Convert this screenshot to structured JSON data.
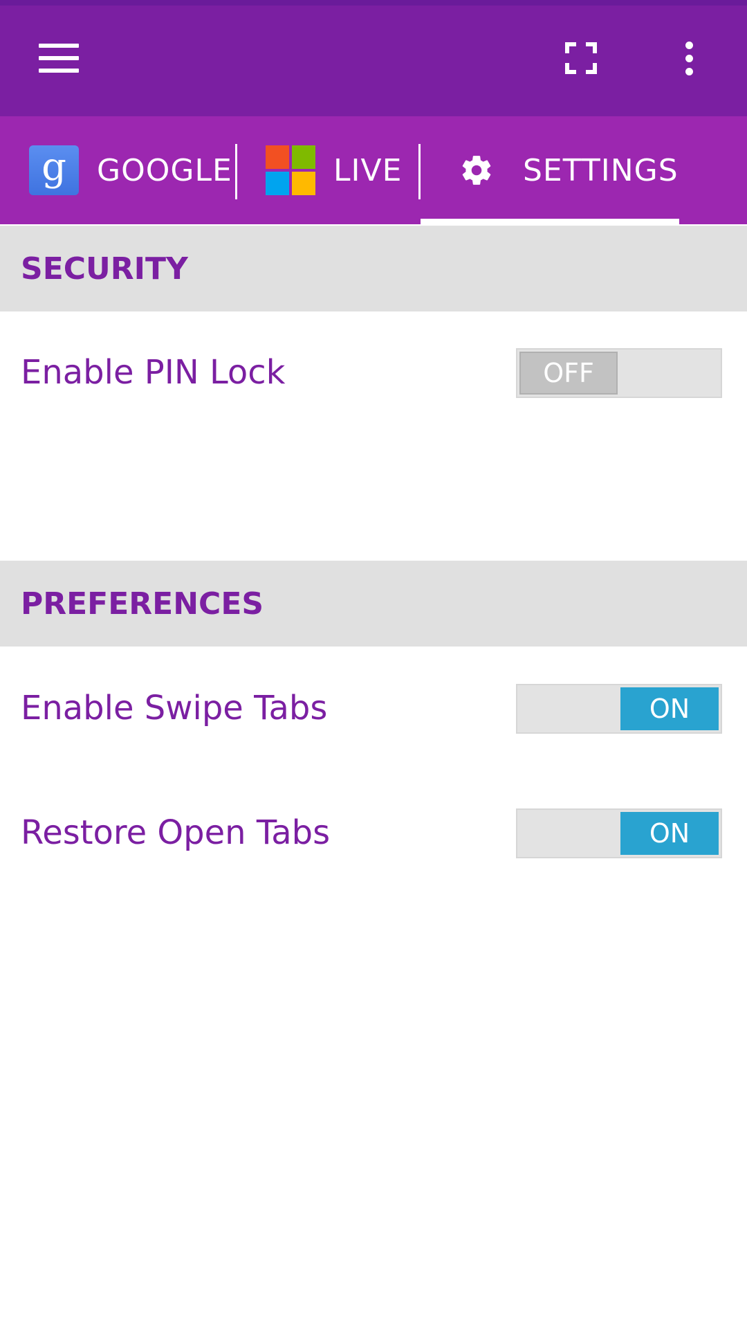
{
  "appbar": {
    "menu_icon": "hamburger-menu-icon",
    "fullscreen_icon": "fullscreen-icon",
    "overflow_icon": "more-vert-icon"
  },
  "tabs": [
    {
      "label": "GOOGLE",
      "icon": "google-logo-icon",
      "selected": false
    },
    {
      "label": "LIVE",
      "icon": "microsoft-logo-icon",
      "selected": false
    },
    {
      "label": "SETTINGS",
      "icon": "gear-icon",
      "selected": true
    }
  ],
  "google_logo_letter": "g",
  "sections": {
    "security": {
      "title": "SECURITY",
      "items": [
        {
          "label": "Enable PIN Lock",
          "state": "OFF"
        }
      ]
    },
    "preferences": {
      "title": "PREFERENCES",
      "items": [
        {
          "label": "Enable Swipe Tabs",
          "state": "ON"
        },
        {
          "label": "Restore Open Tabs",
          "state": "ON"
        }
      ]
    }
  },
  "colors": {
    "appbar": "#7b1fa2",
    "tabbar": "#9c27b0",
    "accent_text": "#7b1fa2",
    "section_bg": "#e0e0e0",
    "toggle_on": "#29a3d0",
    "toggle_off": "#c2c2c2",
    "ms_red": "#f25022",
    "ms_green": "#7fba00",
    "ms_blue": "#00a4ef",
    "ms_yellow": "#ffb900"
  }
}
